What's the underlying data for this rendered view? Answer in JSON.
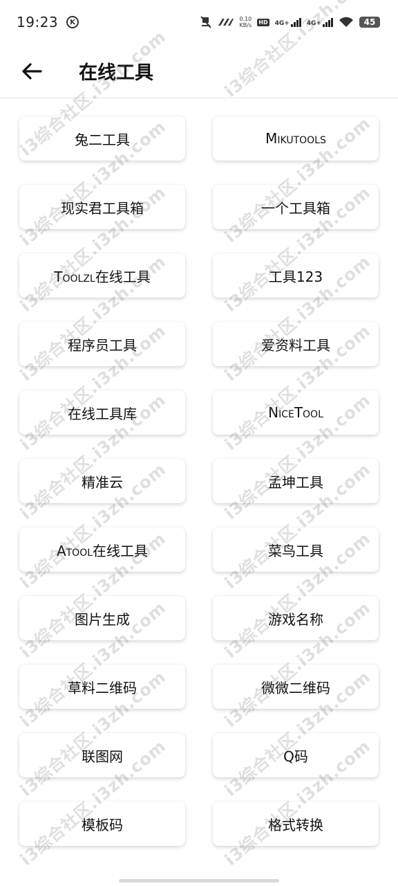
{
  "status_bar": {
    "time": "19:23",
    "k_icon_label": "K",
    "speed_value": "0.10",
    "speed_unit": "KB/s",
    "hd_label": "HD",
    "net1_label": "4G+",
    "net2_label": "4G+",
    "battery_level": "45"
  },
  "header": {
    "title": "在线工具"
  },
  "tools": [
    {
      "label": "兔二工具"
    },
    {
      "label": "Mikutools"
    },
    {
      "label": "现实君工具箱"
    },
    {
      "label": "一个工具箱"
    },
    {
      "label": "Toolzl在线工具"
    },
    {
      "label": "工具123"
    },
    {
      "label": "程序员工具"
    },
    {
      "label": "爱资料工具"
    },
    {
      "label": "在线工具库"
    },
    {
      "label": "NiceTool"
    },
    {
      "label": "精准云"
    },
    {
      "label": "孟坤工具"
    },
    {
      "label": "Atool在线工具"
    },
    {
      "label": "菜鸟工具"
    },
    {
      "label": "图片生成"
    },
    {
      "label": "游戏名称"
    },
    {
      "label": "草料二维码"
    },
    {
      "label": "微微二维码"
    },
    {
      "label": "联图网"
    },
    {
      "label": "Q码"
    },
    {
      "label": "模板码"
    },
    {
      "label": "格式转换"
    }
  ],
  "watermark": {
    "text": "i3综合社区.i3zh.com"
  },
  "icons": {
    "back": "arrow-left-icon",
    "mute": "vibrate-off-icon",
    "wifi": "wifi-icon"
  }
}
